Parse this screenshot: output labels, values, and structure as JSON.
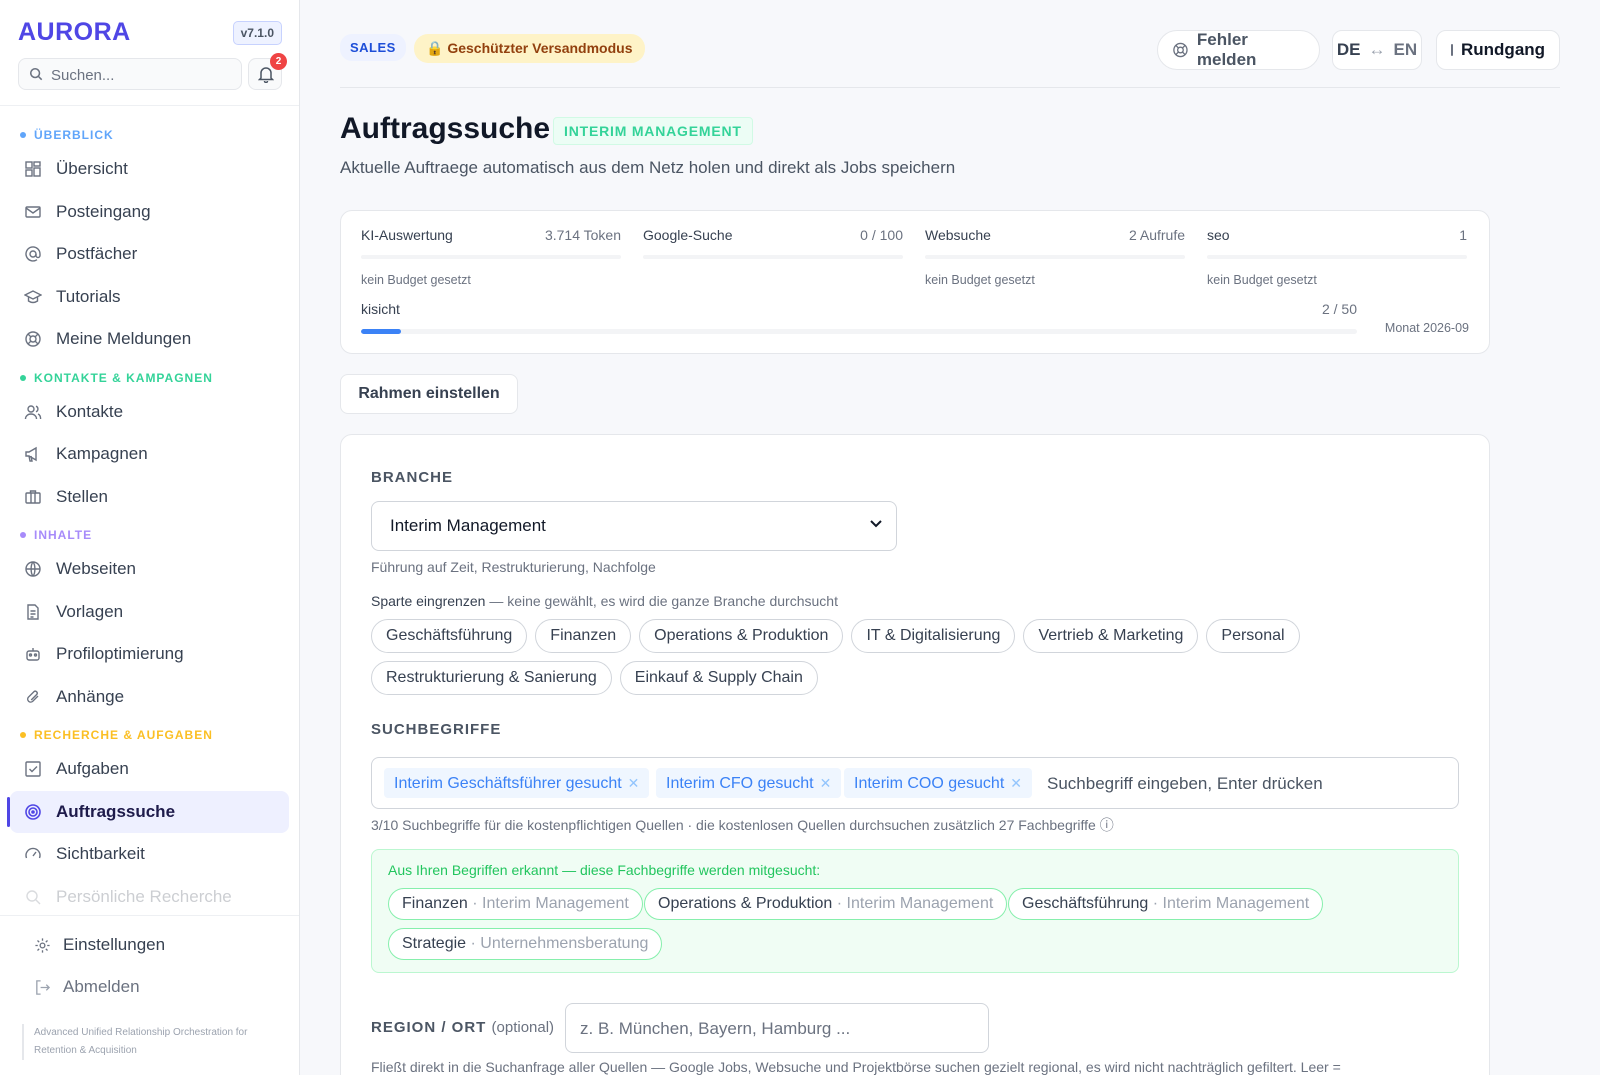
{
  "app": {
    "brand": "AURORA",
    "version": "v7.1.0",
    "notification_count": "2",
    "tagline": "Advanced Unified Relationship Orchestration for Retention & Acquisition"
  },
  "search": {
    "placeholder": "Suchen..."
  },
  "nav": {
    "sections": [
      {
        "label": "ÜBERBLICK",
        "color": "#60a5fa",
        "items": [
          "Übersicht",
          "Posteingang",
          "Postfächer",
          "Tutorials",
          "Meine Meldungen"
        ]
      },
      {
        "label": "KONTAKTE & KAMPAGNEN",
        "color": "#34d399",
        "items": [
          "Kontakte",
          "Kampagnen",
          "Stellen"
        ]
      },
      {
        "label": "INHALTE",
        "color": "#a78bfa",
        "items": [
          "Webseiten",
          "Vorlagen",
          "Profiloptimierung",
          "Anhänge"
        ]
      },
      {
        "label": "RECHERCHE & AUFGABEN",
        "color": "#fbbf24",
        "items": [
          "Aufgaben",
          "Auftragssuche",
          "Sichtbarkeit",
          "Persönliche Recherche"
        ]
      }
    ],
    "active": "Auftragssuche",
    "bottom": [
      "Einstellungen",
      "Abmelden"
    ]
  },
  "topbar": {
    "sales_label": "SALES",
    "safe_mode_label": "Geschützter Versandmodus",
    "report_label": "Fehler melden",
    "lang_de": "DE",
    "lang_arrow": "↔",
    "lang_en": "EN",
    "tour_label": "Rundgang"
  },
  "page": {
    "title": "Auftragssuche",
    "badge": "INTERIM MANAGEMENT",
    "subtitle": "Aktuelle Auftraege automatisch aus dem Netz holen und direkt als Jobs speichern"
  },
  "budget": {
    "metrics": [
      {
        "name": "KI-Auswertung",
        "value": "3.714 Token",
        "note": "kein Budget gesetzt"
      },
      {
        "name": "Google-Suche",
        "value": "0 / 100",
        "note": ""
      },
      {
        "name": "Websuche",
        "value": "2 Aufrufe",
        "note": "kein Budget gesetzt"
      },
      {
        "name": "seo",
        "value": "1",
        "note": "kein Budget gesetzt"
      }
    ],
    "kisicht": {
      "name": "kisicht",
      "value": "2 / 50",
      "progress": 0.04
    },
    "month": "Monat 2026-09"
  },
  "frame_button": "Rahmen einstellen",
  "form": {
    "branche_label": "BRANCHE",
    "branche_value": "Interim Management",
    "branche_hint": "Führung auf Zeit, Restrukturierung, Nachfolge",
    "sparte_label": "Sparte eingrenzen",
    "sparte_hint": "— keine gewählt, es wird die ganze Branche durchsucht",
    "sparten": [
      "Geschäftsführung",
      "Finanzen",
      "Operations & Produktion",
      "IT & Digitalisierung",
      "Vertrieb & Marketing",
      "Personal",
      "Restrukturierung & Sanierung",
      "Einkauf & Supply Chain"
    ],
    "suchbegriffe_label": "SUCHBEGRIFFE",
    "tags": [
      "Interim Geschäftsführer gesucht",
      "Interim CFO gesucht",
      "Interim COO gesucht"
    ],
    "tag_placeholder": "Suchbegriff eingeben, Enter drücken",
    "tag_info": "3/10 Suchbegriffe für die kostenpflichtigen Quellen · die kostenlosen Quellen durchsuchen zusätzlich 27 Fachbegriffe ⓘ",
    "detected_title": "Aus Ihren Begriffen erkannt — diese Fachbegriffe werden mitgesucht:",
    "detected": [
      {
        "term": "Finanzen",
        "sub": " · Interim Management"
      },
      {
        "term": "Operations & Produktion",
        "sub": " · Interim Management"
      },
      {
        "term": "Geschäftsführung",
        "sub": " · Interim Management"
      },
      {
        "term": "Strategie",
        "sub": " · Unternehmensberatung"
      }
    ],
    "region_label": "REGION / ORT",
    "region_optional": "(optional)",
    "region_placeholder": "z. B. München, Bayern, Hamburg ...",
    "region_hint": "Fließt direkt in die Suchanfrage aller Quellen — Google Jobs, Websuche und Projektbörse suchen gezielt regional, es wird nicht nachträglich gefiltert. Leer ="
  }
}
